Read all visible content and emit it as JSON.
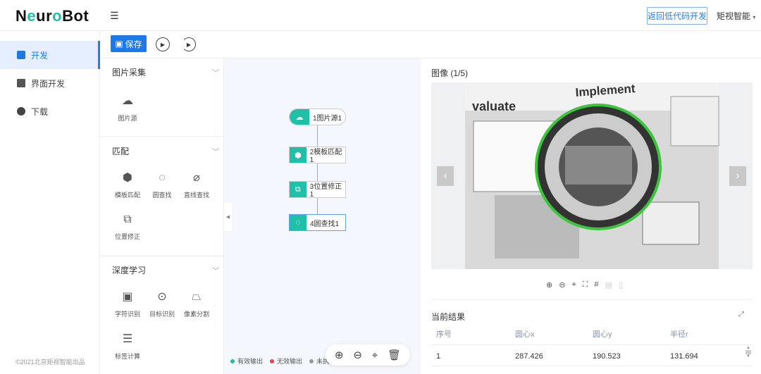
{
  "header": {
    "logo": "NeuroBot",
    "back_button": "返回低代码开发",
    "user": "矩视智能"
  },
  "sidebar": {
    "items": [
      {
        "label": "开发",
        "active": true
      },
      {
        "label": "界面开发"
      },
      {
        "label": "下载"
      }
    ],
    "copyright": "©2021北京矩视智能出品"
  },
  "toolbar": {
    "save_label": "保存"
  },
  "palette": {
    "categories": [
      {
        "title": "图片采集",
        "tools": [
          "图片源"
        ]
      },
      {
        "title": "匹配",
        "tools": [
          "模板匹配",
          "圆查找",
          "直线查找",
          "位置修正"
        ]
      },
      {
        "title": "深度学习",
        "tools": [
          "字符识别",
          "目标识别",
          "像素分割",
          "标签计算"
        ]
      }
    ]
  },
  "flow": {
    "nodes": [
      "1图片源1",
      "2模板匹配1",
      "3位置修正1",
      "4圆查找1"
    ]
  },
  "legend": {
    "valid": "有效输出",
    "invalid": "无效输出",
    "not_run": "未执行",
    "colors": {
      "valid": "#1fbfa5",
      "invalid": "#e8414b",
      "not_run": "#999999"
    }
  },
  "image": {
    "title": "图像  (1/5)",
    "text1": "valuate",
    "text2": "Implement"
  },
  "results": {
    "title": "当前结果",
    "columns": [
      "序号",
      "圆心x",
      "圆心y",
      "半径r"
    ],
    "rows": [
      [
        "1",
        "287.426",
        "190.523",
        "131.694"
      ]
    ]
  }
}
